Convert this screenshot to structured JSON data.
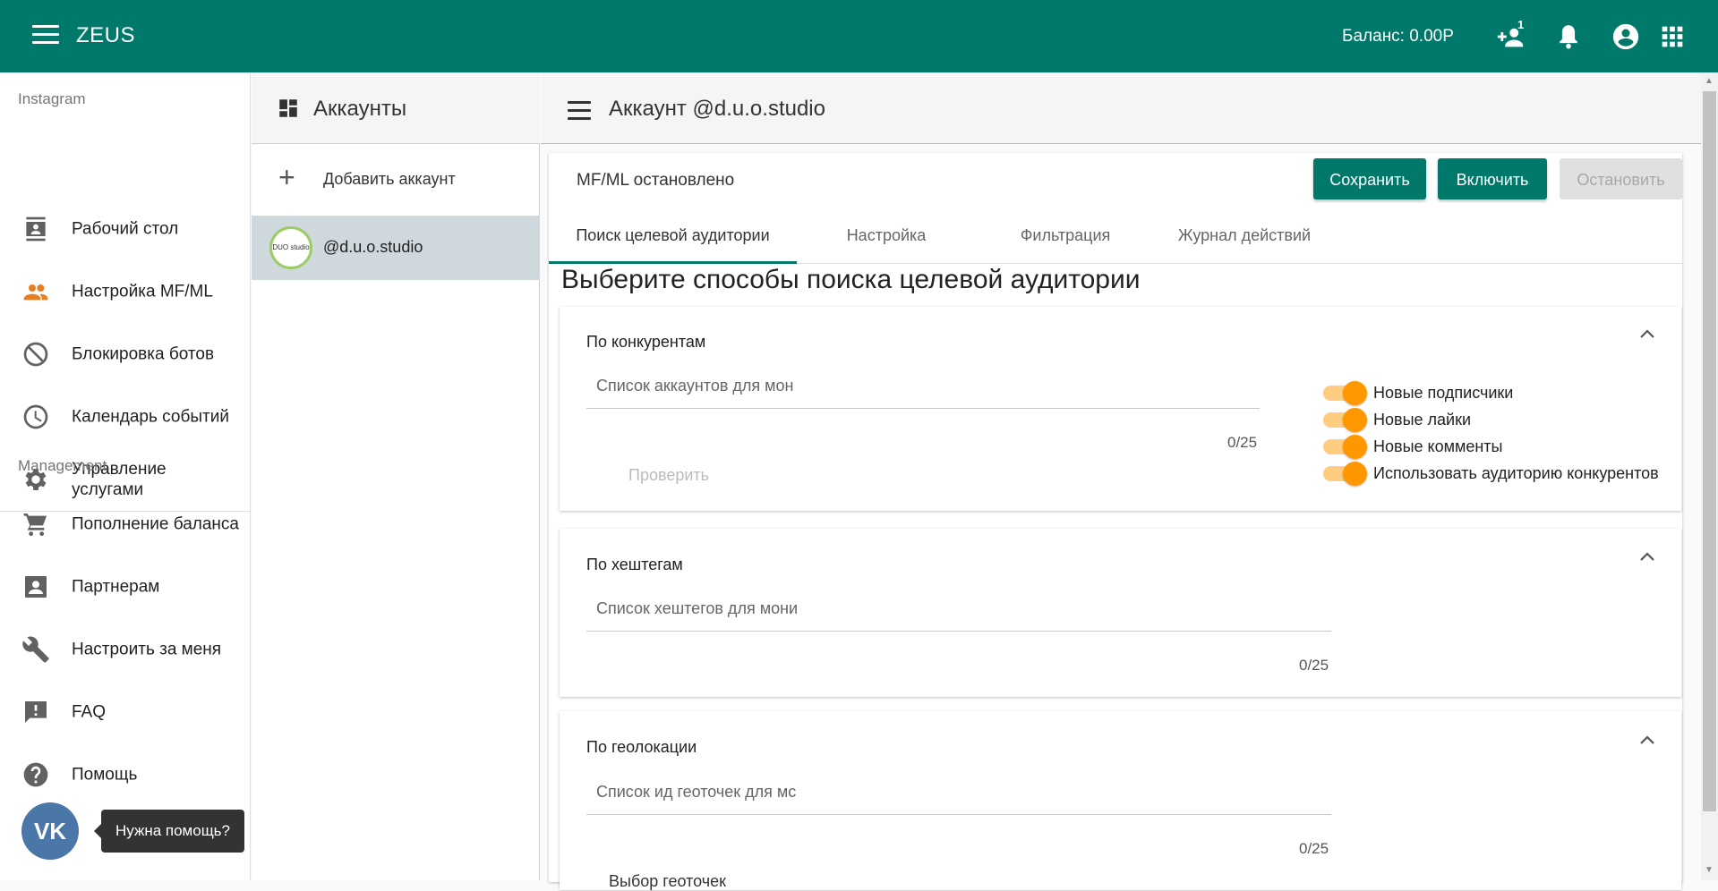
{
  "app": {
    "brand": "ZEUS",
    "balance": "Баланс: 0.00Р",
    "notif_badge": "1"
  },
  "sidebar": {
    "section_instagram": "Instagram",
    "section_management": "Management",
    "items": [
      {
        "label": "Рабочий стол",
        "icon": "contact-icon"
      },
      {
        "label": "Настройка MF/ML",
        "icon": "people-icon"
      },
      {
        "label": "Блокировка ботов",
        "icon": "block-icon"
      },
      {
        "label": "Календарь событий",
        "icon": "clock-icon"
      },
      {
        "label": "Управление услугами",
        "icon": "gear-icon"
      },
      {
        "label": "Пополнение баланса",
        "icon": "cart-icon"
      },
      {
        "label": "Партнерам",
        "icon": "account-box-icon"
      },
      {
        "label": "Настроить за меня",
        "icon": "wrench-icon"
      },
      {
        "label": "FAQ",
        "icon": "feedback-icon"
      },
      {
        "label": "Помощь",
        "icon": "help-icon"
      }
    ]
  },
  "chat": {
    "vk_label": "VK",
    "tooltip": "Нужна помощь?"
  },
  "accounts": {
    "title": "Аккаунты",
    "add_label": "Добавить аккаунт",
    "list": [
      {
        "handle": "@d.u.o.studio",
        "avatar_text": "DUO studio"
      }
    ]
  },
  "main": {
    "title": "Аккаунт @d.u.o.studio",
    "status": "MF/ML остановлено",
    "buttons": {
      "save": "Сохранить",
      "enable": "Включить",
      "stop": "Остановить"
    },
    "tabs": [
      "Поиск целевой аудитории",
      "Настройка",
      "Фильтрация",
      "Журнал действий"
    ],
    "heading": "Выберите способы поиска целевой аудитории"
  },
  "panels": {
    "competitors": {
      "title": "По конкурентам",
      "placeholder": "Список аккаунтов для мон",
      "counter": "0/25",
      "check": "Проверить",
      "toggles": [
        {
          "label": "Новые подписчики",
          "on": true
        },
        {
          "label": "Новые лайки",
          "on": true
        },
        {
          "label": "Новые комменты",
          "on": true
        },
        {
          "label": "Использовать аудиторию конкурентов",
          "on": true
        }
      ]
    },
    "hashtags": {
      "title": "По хештегам",
      "placeholder": "Список хештегов для мони",
      "counter": "0/25"
    },
    "geo": {
      "title": "По геолокации",
      "placeholder": "Список ид геоточек для мс",
      "counter": "0/25",
      "cut_label": "Выбор геоточек"
    }
  },
  "colors": {
    "primary": "#00796b",
    "accent": "#ff9800",
    "selected_row": "#cfd8dc"
  }
}
